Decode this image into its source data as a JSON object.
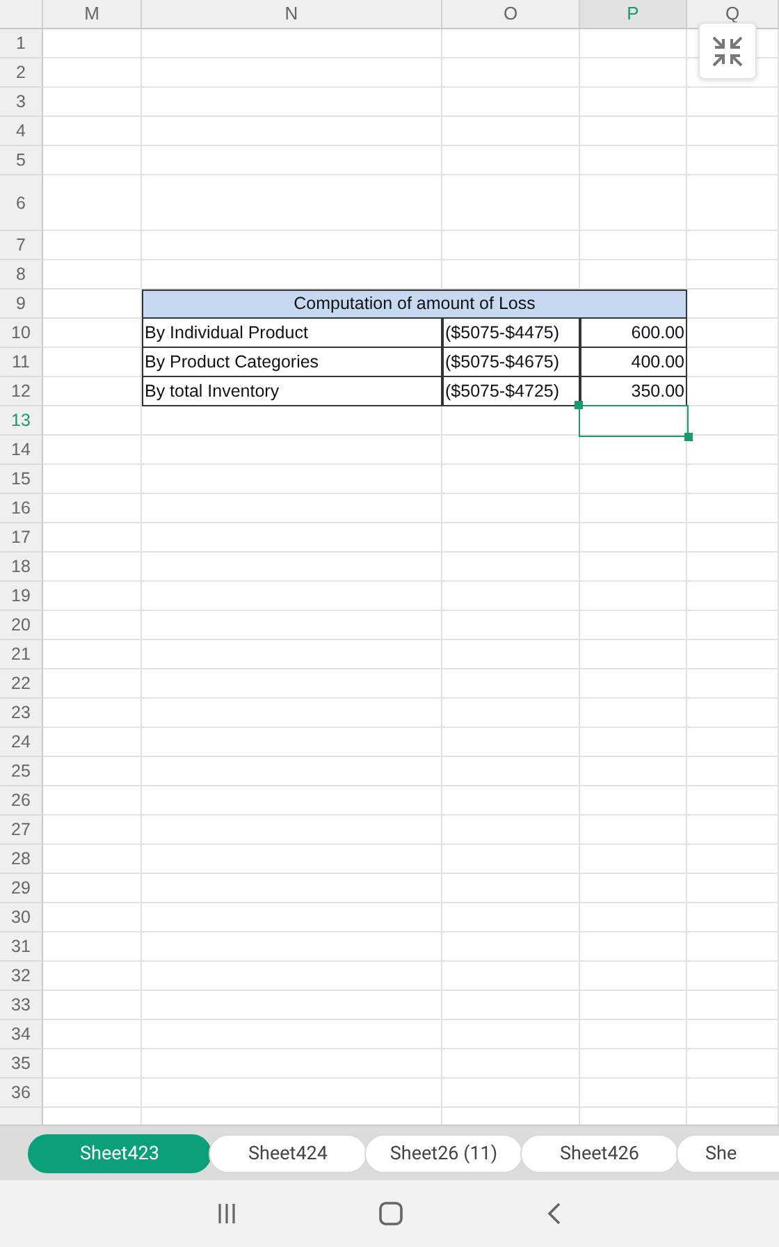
{
  "columns": [
    {
      "label": "M",
      "selected": false
    },
    {
      "label": "N",
      "selected": false
    },
    {
      "label": "O",
      "selected": false
    },
    {
      "label": "P",
      "selected": true
    },
    {
      "label": "Q",
      "selected": false
    }
  ],
  "rows": [
    {
      "number": "1",
      "selected": false
    },
    {
      "number": "2",
      "selected": false
    },
    {
      "number": "3",
      "selected": false
    },
    {
      "number": "4",
      "selected": false
    },
    {
      "number": "5",
      "selected": false
    },
    {
      "number": "6",
      "selected": false,
      "kind": "tall"
    },
    {
      "number": "7",
      "selected": false
    },
    {
      "number": "8",
      "selected": false
    },
    {
      "number": "9",
      "selected": false,
      "kind": "title",
      "text": "Computation of amount of Loss"
    },
    {
      "number": "10",
      "selected": false,
      "kind": "data",
      "cells": [
        "By Individual Product",
        "($5075-$4475)",
        "600.00"
      ]
    },
    {
      "number": "11",
      "selected": false,
      "kind": "data",
      "cells": [
        "By Product Categories",
        "($5075-$4675)",
        "400.00"
      ]
    },
    {
      "number": "12",
      "selected": false,
      "kind": "data",
      "cells": [
        "By total Inventory",
        "($5075-$4725)",
        "350.00"
      ]
    },
    {
      "number": "13",
      "selected": true
    },
    {
      "number": "14",
      "selected": false
    },
    {
      "number": "15",
      "selected": false
    },
    {
      "number": "16",
      "selected": false
    },
    {
      "number": "17",
      "selected": false
    },
    {
      "number": "18",
      "selected": false
    },
    {
      "number": "19",
      "selected": false
    },
    {
      "number": "20",
      "selected": false
    },
    {
      "number": "21",
      "selected": false
    },
    {
      "number": "22",
      "selected": false
    },
    {
      "number": "23",
      "selected": false
    },
    {
      "number": "24",
      "selected": false
    },
    {
      "number": "25",
      "selected": false
    },
    {
      "number": "26",
      "selected": false
    },
    {
      "number": "27",
      "selected": false
    },
    {
      "number": "28",
      "selected": false
    },
    {
      "number": "29",
      "selected": false
    },
    {
      "number": "30",
      "selected": false
    },
    {
      "number": "31",
      "selected": false
    },
    {
      "number": "32",
      "selected": false
    },
    {
      "number": "33",
      "selected": false
    },
    {
      "number": "34",
      "selected": false
    },
    {
      "number": "35",
      "selected": false
    },
    {
      "number": "36",
      "selected": false
    }
  ],
  "sheet_tabs": [
    {
      "label": "Sheet423",
      "selected": true
    },
    {
      "label": "Sheet424",
      "selected": false
    },
    {
      "label": "Sheet26 (11)",
      "selected": false
    },
    {
      "label": "Sheet426",
      "selected": false
    },
    {
      "label": "She",
      "selected": false
    }
  ]
}
